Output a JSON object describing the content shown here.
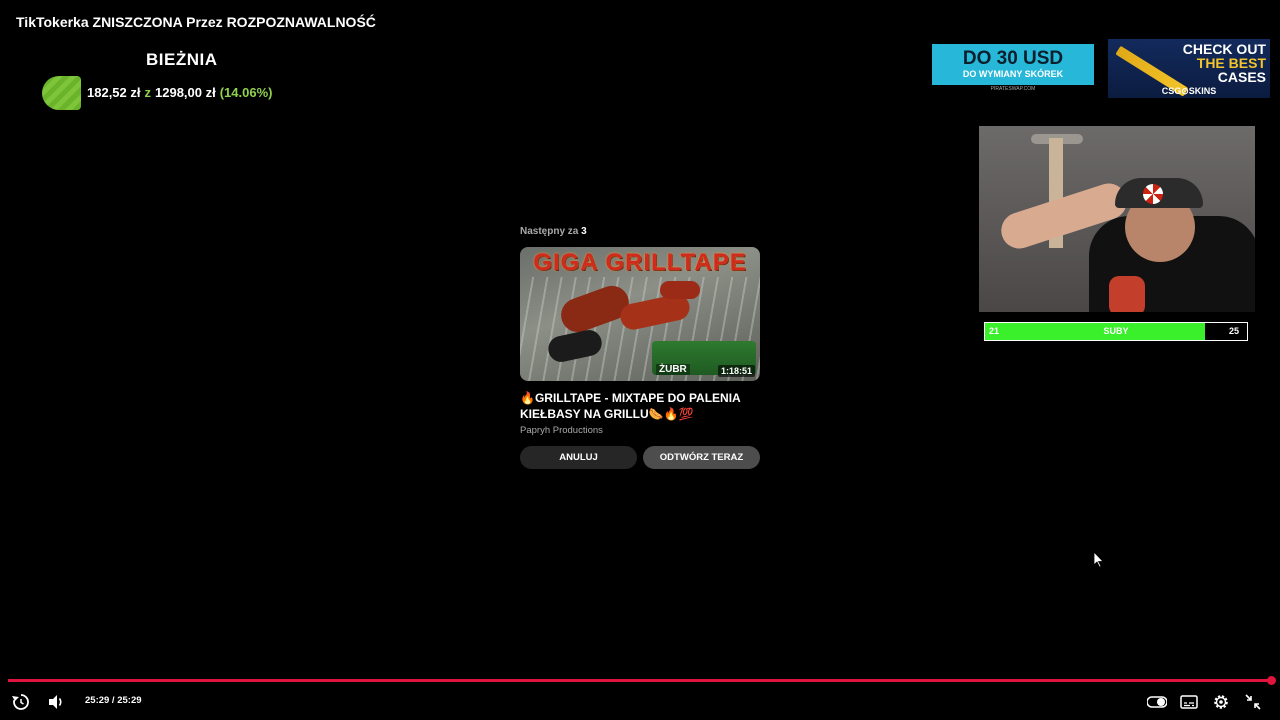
{
  "video": {
    "title": "TikTokerka ZNISZCZONA Przez ROZPOZNAWALNOŚĆ"
  },
  "goal_overlay": {
    "name": "BIEŻNIA",
    "current": "182,52 zł",
    "separator": "z",
    "target": "1298,00 zł",
    "percent": "(14.06%)",
    "progress": 0.1406
  },
  "ads": {
    "pirateswap": {
      "headline": "DO 30 USD",
      "subline": "DO WYMIANY SKÓREK",
      "footer": "PIRATESWAP.COM"
    },
    "csgoskins": {
      "line1": "CHECK OUT",
      "line2": "THE BEST",
      "line3": "CASES",
      "brand": "CSG⊙SKINS"
    }
  },
  "sub_bar": {
    "left": "21",
    "label": "SUBY",
    "right": "25",
    "fill_fraction": 0.84
  },
  "up_next": {
    "label_prefix": "Następny za ",
    "countdown": "3",
    "thumbnail_title": "GIGA GRILLTAPE",
    "thumbnail_badge": "ŻUBR",
    "duration": "1:18:51",
    "title": "🔥GRILLTAPE - MIXTAPE DO PALENIA KIEŁBASY NA GRILLU🌭🔥💯",
    "channel": "Papryh Productions",
    "cancel_label": "ANULUJ",
    "play_now_label": "ODTWÓRZ TERAZ"
  },
  "player": {
    "time": "25:29 / 25:29",
    "progress": 1.0,
    "accent_color": "#e0143c",
    "icons": [
      "replay-icon",
      "volume-icon",
      "autoplay-toggle-icon",
      "subtitles-icon",
      "settings-icon",
      "exit-fullscreen-icon"
    ]
  }
}
